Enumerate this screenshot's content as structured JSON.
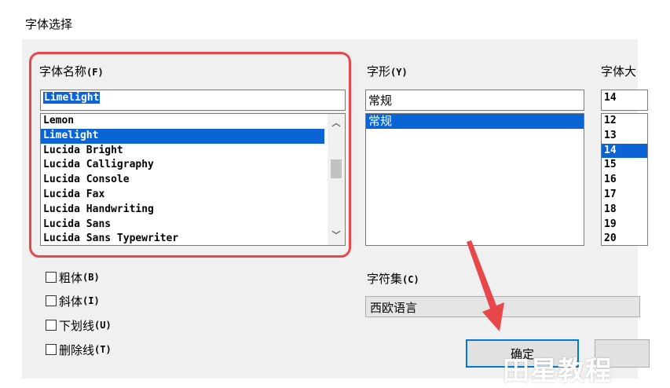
{
  "window": {
    "title": "字体选择"
  },
  "font_name": {
    "label": "字体名称",
    "accel": "(F)",
    "value": "Limelight",
    "items": [
      "Lemon",
      "Limelight",
      "Lucida Bright",
      "Lucida Calligraphy",
      "Lucida Console",
      "Lucida Fax",
      "Lucida Handwriting",
      "Lucida Sans",
      "Lucida Sans Typewriter"
    ],
    "selected": "Limelight"
  },
  "font_style": {
    "label": "字形",
    "accel": "(Y)",
    "value": "常规",
    "items": [
      "常规"
    ],
    "selected": "常规"
  },
  "font_size": {
    "label": "字体大",
    "value": "14",
    "items": [
      "12",
      "13",
      "14",
      "15",
      "16",
      "17",
      "18",
      "19",
      "20"
    ],
    "selected": "14"
  },
  "effects": [
    {
      "label": "粗体",
      "accel": "(B)",
      "checked": false
    },
    {
      "label": "斜体",
      "accel": "(I)",
      "checked": false
    },
    {
      "label": "下划线",
      "accel": "(U)",
      "checked": false
    },
    {
      "label": "删除线",
      "accel": "(T)",
      "checked": false
    }
  ],
  "charset": {
    "label": "字符集",
    "accel": "(C)",
    "value": "西欧语言"
  },
  "buttons": {
    "ok_label": "确定"
  },
  "watermark": "田星教程",
  "colors": {
    "selection": "#0a64d6",
    "highlight_annotation": "#e8474a",
    "arrow_annotation": "#e8474a"
  }
}
